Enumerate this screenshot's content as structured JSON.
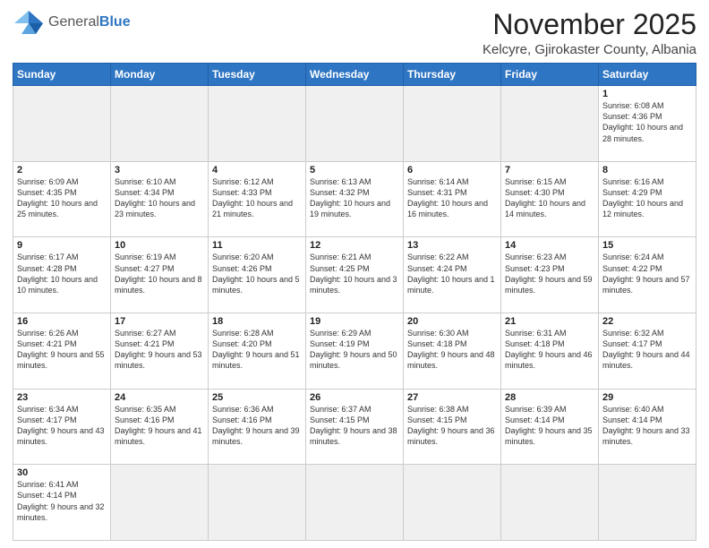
{
  "header": {
    "logo_general": "General",
    "logo_blue": "Blue",
    "title": "November 2025",
    "subtitle": "Kelcyre, Gjirokaster County, Albania"
  },
  "weekdays": [
    "Sunday",
    "Monday",
    "Tuesday",
    "Wednesday",
    "Thursday",
    "Friday",
    "Saturday"
  ],
  "weeks": [
    [
      {
        "day": "",
        "info": "",
        "empty": true
      },
      {
        "day": "",
        "info": "",
        "empty": true
      },
      {
        "day": "",
        "info": "",
        "empty": true
      },
      {
        "day": "",
        "info": "",
        "empty": true
      },
      {
        "day": "",
        "info": "",
        "empty": true
      },
      {
        "day": "",
        "info": "",
        "empty": true
      },
      {
        "day": "1",
        "info": "Sunrise: 6:08 AM\nSunset: 4:36 PM\nDaylight: 10 hours\nand 28 minutes."
      }
    ],
    [
      {
        "day": "2",
        "info": "Sunrise: 6:09 AM\nSunset: 4:35 PM\nDaylight: 10 hours\nand 25 minutes."
      },
      {
        "day": "3",
        "info": "Sunrise: 6:10 AM\nSunset: 4:34 PM\nDaylight: 10 hours\nand 23 minutes."
      },
      {
        "day": "4",
        "info": "Sunrise: 6:12 AM\nSunset: 4:33 PM\nDaylight: 10 hours\nand 21 minutes."
      },
      {
        "day": "5",
        "info": "Sunrise: 6:13 AM\nSunset: 4:32 PM\nDaylight: 10 hours\nand 19 minutes."
      },
      {
        "day": "6",
        "info": "Sunrise: 6:14 AM\nSunset: 4:31 PM\nDaylight: 10 hours\nand 16 minutes."
      },
      {
        "day": "7",
        "info": "Sunrise: 6:15 AM\nSunset: 4:30 PM\nDaylight: 10 hours\nand 14 minutes."
      },
      {
        "day": "8",
        "info": "Sunrise: 6:16 AM\nSunset: 4:29 PM\nDaylight: 10 hours\nand 12 minutes."
      }
    ],
    [
      {
        "day": "9",
        "info": "Sunrise: 6:17 AM\nSunset: 4:28 PM\nDaylight: 10 hours\nand 10 minutes."
      },
      {
        "day": "10",
        "info": "Sunrise: 6:19 AM\nSunset: 4:27 PM\nDaylight: 10 hours\nand 8 minutes."
      },
      {
        "day": "11",
        "info": "Sunrise: 6:20 AM\nSunset: 4:26 PM\nDaylight: 10 hours\nand 5 minutes."
      },
      {
        "day": "12",
        "info": "Sunrise: 6:21 AM\nSunset: 4:25 PM\nDaylight: 10 hours\nand 3 minutes."
      },
      {
        "day": "13",
        "info": "Sunrise: 6:22 AM\nSunset: 4:24 PM\nDaylight: 10 hours\nand 1 minute."
      },
      {
        "day": "14",
        "info": "Sunrise: 6:23 AM\nSunset: 4:23 PM\nDaylight: 9 hours\nand 59 minutes."
      },
      {
        "day": "15",
        "info": "Sunrise: 6:24 AM\nSunset: 4:22 PM\nDaylight: 9 hours\nand 57 minutes."
      }
    ],
    [
      {
        "day": "16",
        "info": "Sunrise: 6:26 AM\nSunset: 4:21 PM\nDaylight: 9 hours\nand 55 minutes."
      },
      {
        "day": "17",
        "info": "Sunrise: 6:27 AM\nSunset: 4:21 PM\nDaylight: 9 hours\nand 53 minutes."
      },
      {
        "day": "18",
        "info": "Sunrise: 6:28 AM\nSunset: 4:20 PM\nDaylight: 9 hours\nand 51 minutes."
      },
      {
        "day": "19",
        "info": "Sunrise: 6:29 AM\nSunset: 4:19 PM\nDaylight: 9 hours\nand 50 minutes."
      },
      {
        "day": "20",
        "info": "Sunrise: 6:30 AM\nSunset: 4:18 PM\nDaylight: 9 hours\nand 48 minutes."
      },
      {
        "day": "21",
        "info": "Sunrise: 6:31 AM\nSunset: 4:18 PM\nDaylight: 9 hours\nand 46 minutes."
      },
      {
        "day": "22",
        "info": "Sunrise: 6:32 AM\nSunset: 4:17 PM\nDaylight: 9 hours\nand 44 minutes."
      }
    ],
    [
      {
        "day": "23",
        "info": "Sunrise: 6:34 AM\nSunset: 4:17 PM\nDaylight: 9 hours\nand 43 minutes."
      },
      {
        "day": "24",
        "info": "Sunrise: 6:35 AM\nSunset: 4:16 PM\nDaylight: 9 hours\nand 41 minutes."
      },
      {
        "day": "25",
        "info": "Sunrise: 6:36 AM\nSunset: 4:16 PM\nDaylight: 9 hours\nand 39 minutes."
      },
      {
        "day": "26",
        "info": "Sunrise: 6:37 AM\nSunset: 4:15 PM\nDaylight: 9 hours\nand 38 minutes."
      },
      {
        "day": "27",
        "info": "Sunrise: 6:38 AM\nSunset: 4:15 PM\nDaylight: 9 hours\nand 36 minutes."
      },
      {
        "day": "28",
        "info": "Sunrise: 6:39 AM\nSunset: 4:14 PM\nDaylight: 9 hours\nand 35 minutes."
      },
      {
        "day": "29",
        "info": "Sunrise: 6:40 AM\nSunset: 4:14 PM\nDaylight: 9 hours\nand 33 minutes."
      }
    ],
    [
      {
        "day": "30",
        "info": "Sunrise: 6:41 AM\nSunset: 4:14 PM\nDaylight: 9 hours\nand 32 minutes."
      },
      {
        "day": "",
        "info": "",
        "empty": true
      },
      {
        "day": "",
        "info": "",
        "empty": true
      },
      {
        "day": "",
        "info": "",
        "empty": true
      },
      {
        "day": "",
        "info": "",
        "empty": true
      },
      {
        "day": "",
        "info": "",
        "empty": true
      },
      {
        "day": "",
        "info": "",
        "empty": true
      }
    ]
  ]
}
